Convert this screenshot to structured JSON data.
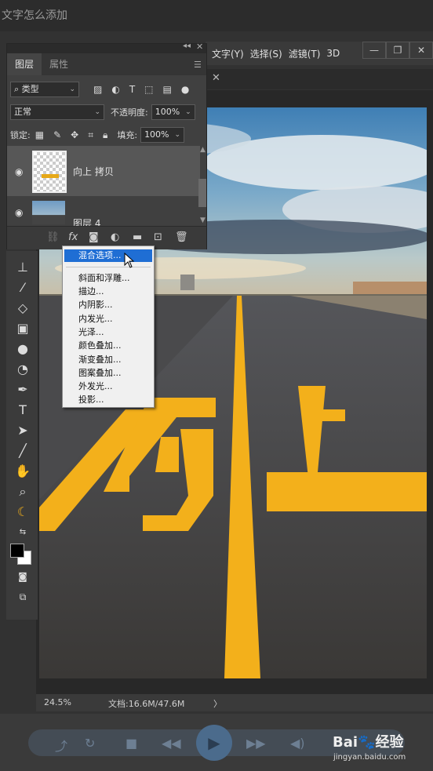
{
  "video_title": "文字怎么添加",
  "menubar": {
    "items": [
      "文字(Y)",
      "选择(S)",
      "滤镜(T)",
      "3D"
    ]
  },
  "window_controls": {
    "minimize": "—",
    "restore": "❐",
    "close": "✕"
  },
  "doc_tab": {
    "close": "✕"
  },
  "layers_panel": {
    "tabs": [
      "图层",
      "属性"
    ],
    "filter_label": "类型",
    "blend_mode": "正常",
    "opacity_label": "不透明度:",
    "opacity_value": "100%",
    "lock_label": "锁定:",
    "fill_label": "填充:",
    "fill_value": "100%",
    "layers": [
      {
        "name": "向上 拷贝",
        "selected": true
      },
      {
        "name": "图层 4",
        "selected": false
      }
    ]
  },
  "context_menu": {
    "items": [
      "混合选项...",
      "斜面和浮雕...",
      "描边...",
      "内阴影...",
      "内发光...",
      "光泽...",
      "颜色叠加...",
      "渐变叠加...",
      "图案叠加...",
      "外发光...",
      "投影..."
    ],
    "highlighted": "混合选项..."
  },
  "statusbar": {
    "zoom": "24.5%",
    "doc_info": "文档:16.6M/47.6M",
    "arrow": "〉"
  },
  "canvas_text": "向上",
  "watermark": {
    "brand": "Bai🐾经验",
    "url": "jingyan.baidu.com"
  },
  "colors": {
    "accent_yellow": "#f3b01b",
    "highlight_blue": "#1f6ed4",
    "panel_bg": "#404040"
  }
}
